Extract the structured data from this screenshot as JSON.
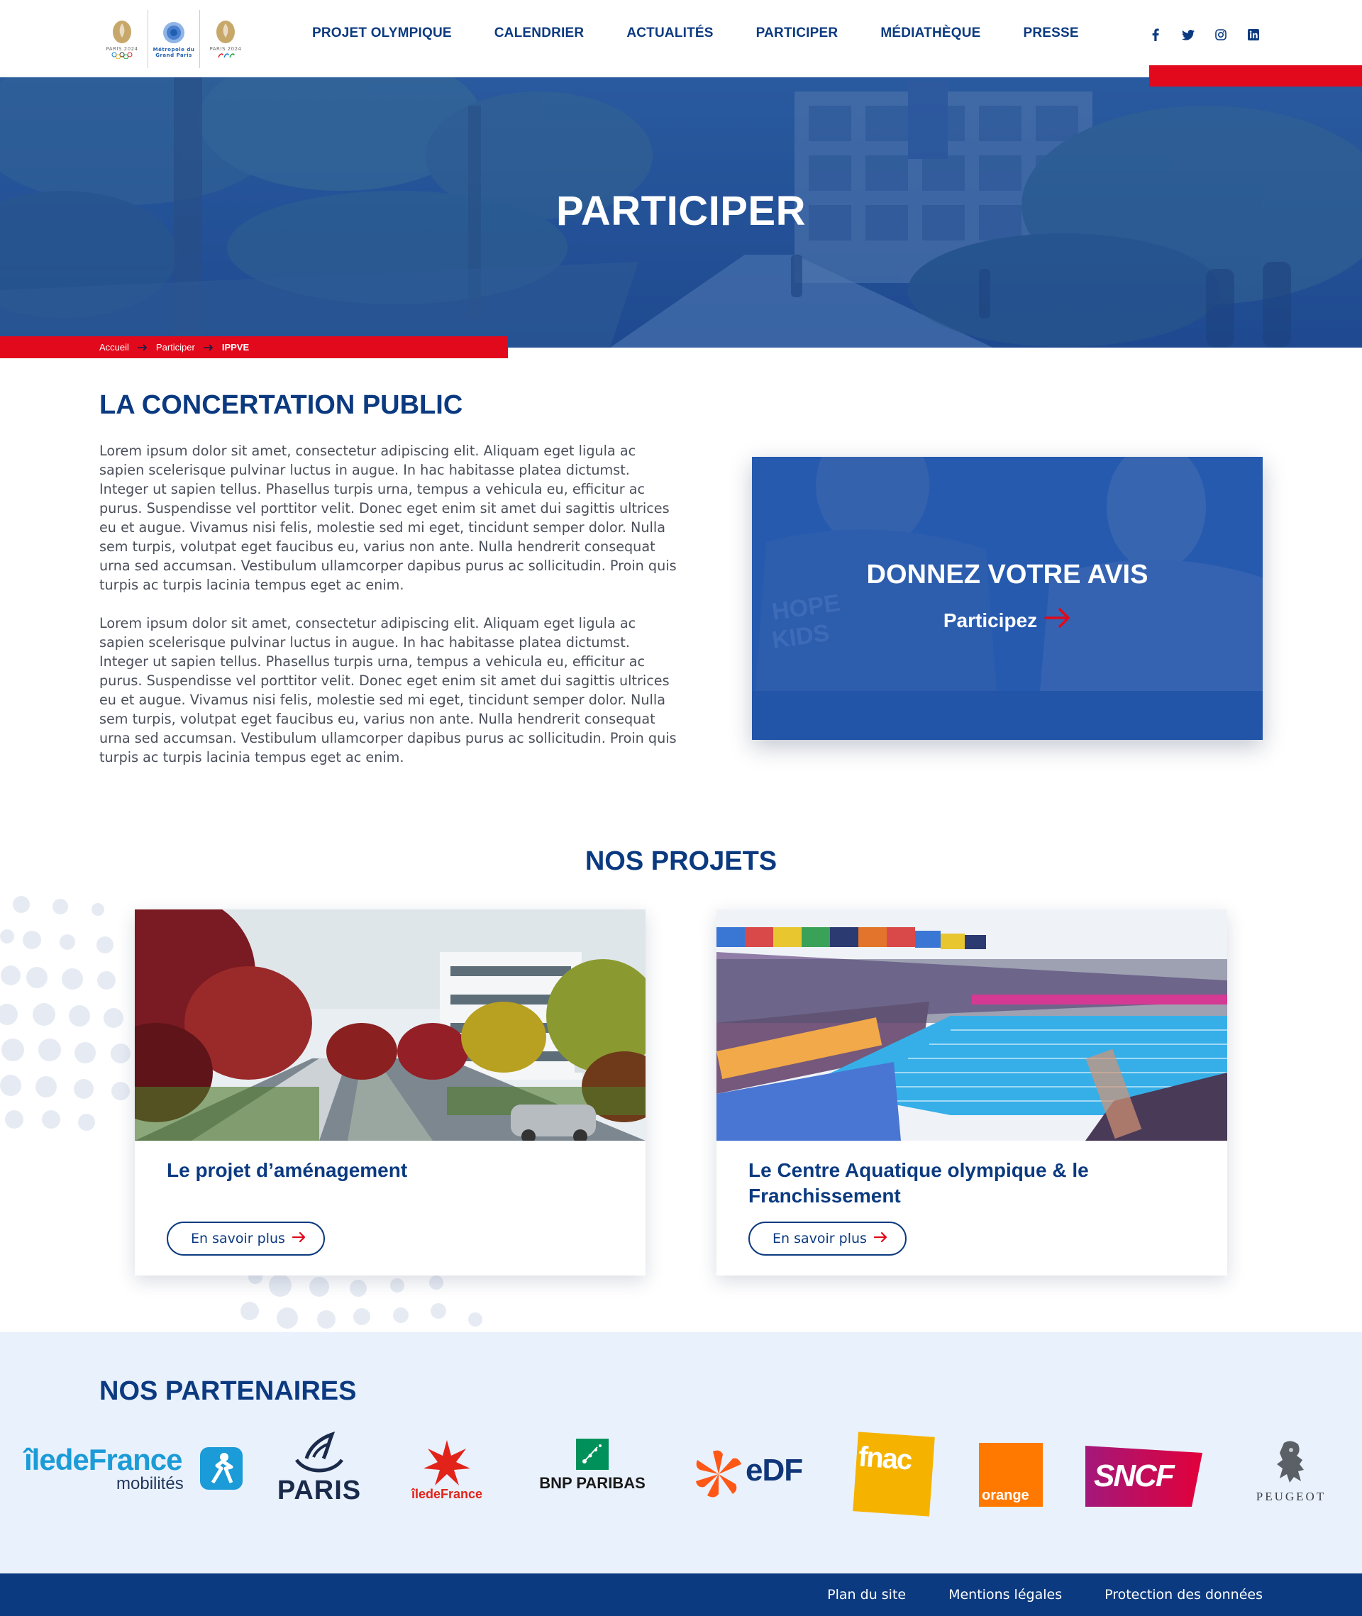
{
  "header": {
    "logos": [
      {
        "name": "paris-2024-olympic",
        "label": "PARIS 2024"
      },
      {
        "name": "metropole-grand-paris",
        "label": "Métropole du Grand Paris"
      },
      {
        "name": "paris-2024-paralympic",
        "label": "PARIS 2024"
      }
    ],
    "nav": [
      "PROJET OLYMPIQUE",
      "CALENDRIER",
      "ACTUALITÉS",
      "PARTICIPER",
      "MÉDIATHÈQUE",
      "PRESSE"
    ],
    "social": [
      "facebook-icon",
      "twitter-icon",
      "instagram-icon",
      "linkedin-icon"
    ]
  },
  "hero": {
    "title": "PARTICIPER",
    "breadcrumb": [
      "Accueil",
      "Participer",
      "IPPVE"
    ]
  },
  "concertation": {
    "title": "LA CONCERTATION PUBLIC",
    "paragraphs": [
      "Lorem ipsum dolor sit amet, consectetur adipiscing elit. Aliquam eget ligula ac sapien scelerisque pulvinar luctus in augue. In hac habitasse platea dictumst. Integer ut sapien tellus. Phasellus turpis urna, tempus a vehicula eu, efficitur ac purus. Suspendisse vel porttitor velit. Donec eget enim sit amet dui sagittis ultrices eu et augue. Vivamus nisi felis, molestie sed mi eget, tincidunt semper dolor. Nulla sem turpis, volutpat eget faucibus eu, varius non ante. Nulla hendrerit consequat urna sed accumsan. Vestibulum ullamcorper dapibus purus ac sollicitudin. Proin quis turpis ac turpis lacinia tempus eget ac enim.",
      "Lorem ipsum dolor sit amet, consectetur adipiscing elit. Aliquam eget ligula ac sapien scelerisque pulvinar luctus in augue. In hac habitasse platea dictumst. Integer ut sapien tellus. Phasellus turpis urna, tempus a vehicula eu, efficitur ac purus. Suspendisse vel porttitor velit. Donec eget enim sit amet dui sagittis ultrices eu et augue. Vivamus nisi felis, molestie sed mi eget, tincidunt semper dolor. Nulla sem turpis, volutpat eget faucibus eu, varius non ante. Nulla hendrerit consequat urna sed accumsan. Vestibulum ullamcorper dapibus purus ac sollicitudin. Proin quis turpis ac turpis lacinia tempus eget ac enim."
    ],
    "card": {
      "title": "DONNEZ VOTRE AVIS",
      "link": "Participez"
    }
  },
  "projects": {
    "title": "NOS PROJETS",
    "items": [
      {
        "title": "Le projet d’aménagement",
        "button": "En savoir plus"
      },
      {
        "title": "Le Centre Aquatique olympique & le Franchissement",
        "button": "En savoir plus"
      }
    ]
  },
  "partners": {
    "title": "NOS PARTENAIRES",
    "logos": [
      {
        "name": "iledefrance-mobilites-logo",
        "text": "îledeFrance",
        "sub": "mobilités"
      },
      {
        "name": "paris-logo",
        "text": "PARIS"
      },
      {
        "name": "region-iledefrance-logo",
        "text": "îledeFrance"
      },
      {
        "name": "bnp-paribas-logo",
        "text": "BNP PARIBAS"
      },
      {
        "name": "edf-logo",
        "text": "eDF"
      },
      {
        "name": "fnac-logo",
        "text": "fnac"
      },
      {
        "name": "orange-logo",
        "text": "orange"
      },
      {
        "name": "sncf-logo",
        "text": "SNCF"
      },
      {
        "name": "peugeot-logo",
        "text": "PEUGEOT"
      }
    ]
  },
  "footer": {
    "links": [
      "Plan du site",
      "Mentions légales",
      "Protection des données"
    ]
  },
  "colors": {
    "primary": "#0b3a80",
    "accent": "#e1091b",
    "partners_bg": "#e9f1fc"
  }
}
